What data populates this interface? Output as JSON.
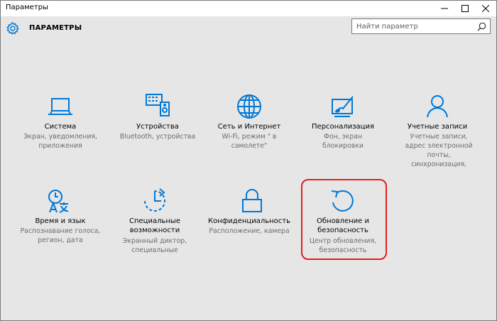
{
  "window": {
    "title": "Параметры",
    "min_label": "minimize",
    "max_label": "maximize",
    "close_label": "close"
  },
  "header": {
    "title": "ПАРАМЕТРЫ",
    "gear_icon": "gear-icon"
  },
  "search": {
    "placeholder": "Найти параметр",
    "value": "",
    "icon": "search-icon"
  },
  "accent_color": "#0078d7",
  "highlight_color": "#e02020",
  "tiles": [
    {
      "name": "Система",
      "desc": "Экран, уведомления, приложения",
      "icon": "laptop-icon"
    },
    {
      "name": "Устройства",
      "desc": "Bluetooth, устройства",
      "icon": "devices-icon"
    },
    {
      "name": "Сеть и Интернет",
      "desc": "Wi-Fi, режим \" в самолете\"",
      "icon": "globe-icon"
    },
    {
      "name": "Персонализация",
      "desc": "Фон, экран блокировки",
      "icon": "paint-icon"
    },
    {
      "name": "Учетные записи",
      "desc": "Учетные записи, адрес электронной почты, синхронизация,",
      "icon": "person-icon"
    },
    {
      "name": "Время и язык",
      "desc": "Распознавание голоса, регион, дата",
      "icon": "time-language-icon"
    },
    {
      "name": "Специальные возможности",
      "desc": "Экранный диктор, специальные",
      "icon": "ease-of-access-icon"
    },
    {
      "name": "Конфиденциальность",
      "desc": "Расположение, камера",
      "icon": "lock-icon"
    },
    {
      "name": "Обновление и безопасность",
      "desc": "Центр обновления, безопасность",
      "icon": "update-icon"
    }
  ]
}
